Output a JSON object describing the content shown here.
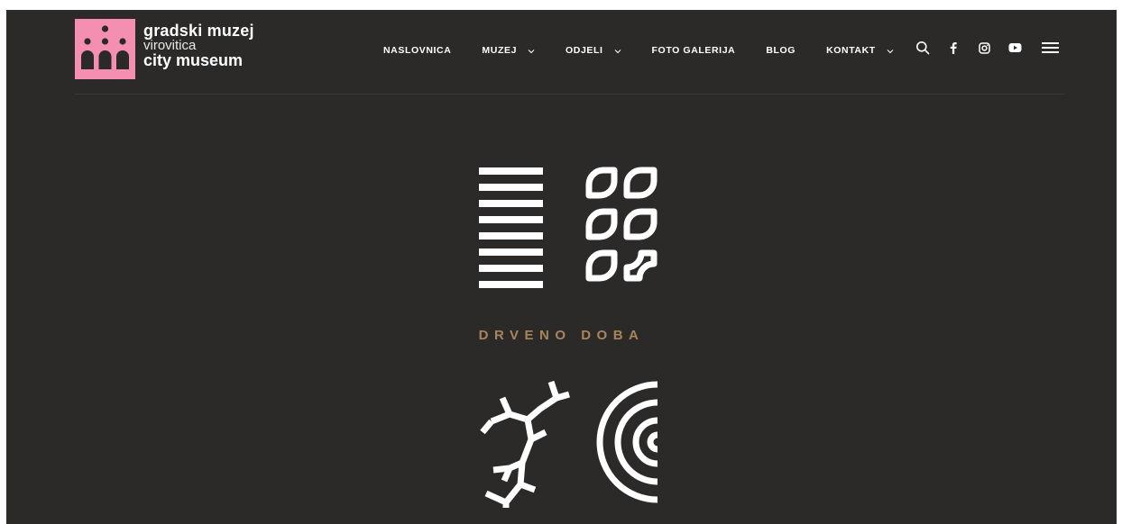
{
  "logo": {
    "line1": "gradski muzej",
    "line2": "virovitica",
    "line3": "city museum",
    "color": "#f48fb1"
  },
  "nav": {
    "items": [
      {
        "label": "NASLOVNICA",
        "has_dropdown": false
      },
      {
        "label": "MUZEJ",
        "has_dropdown": true
      },
      {
        "label": "ODJELI",
        "has_dropdown": true
      },
      {
        "label": "FOTO GALERIJA",
        "has_dropdown": false
      },
      {
        "label": "BLOG",
        "has_dropdown": false
      },
      {
        "label": "KONTAKT",
        "has_dropdown": true
      }
    ]
  },
  "tools": {
    "icons": [
      "search-icon",
      "facebook-icon",
      "instagram-icon",
      "youtube-icon",
      "menu-icon"
    ]
  },
  "hero": {
    "title": "DRVENO DOBA",
    "accent_color": "#a8845a",
    "symbols": [
      "stripes-icon",
      "leaves-icon",
      "branch-icon",
      "tree-rings-icon"
    ]
  },
  "colors": {
    "background": "#2c2a29",
    "foreground": "#ffffff"
  }
}
